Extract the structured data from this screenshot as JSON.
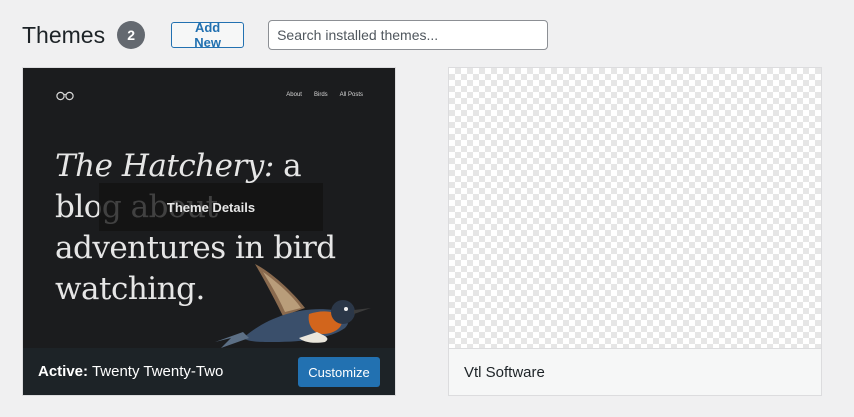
{
  "header": {
    "title": "Themes",
    "count": "2",
    "add_new_label": "Add New",
    "search_placeholder": "Search installed themes..."
  },
  "active_theme": {
    "preview": {
      "nav": [
        "About",
        "Birds",
        "All Posts"
      ],
      "hero_italic": "The Hatchery:",
      "hero_rest": " a blog about adventures in bird watching."
    },
    "details_label": "Theme Details",
    "active_prefix": "Active:",
    "name": "Twenty Twenty-Two",
    "customize_label": "Customize"
  },
  "other_theme": {
    "name": "Vtl Software"
  },
  "colors": {
    "accent": "#2271b1",
    "dark_footer": "#1d2327",
    "background": "#f0f0f1"
  }
}
